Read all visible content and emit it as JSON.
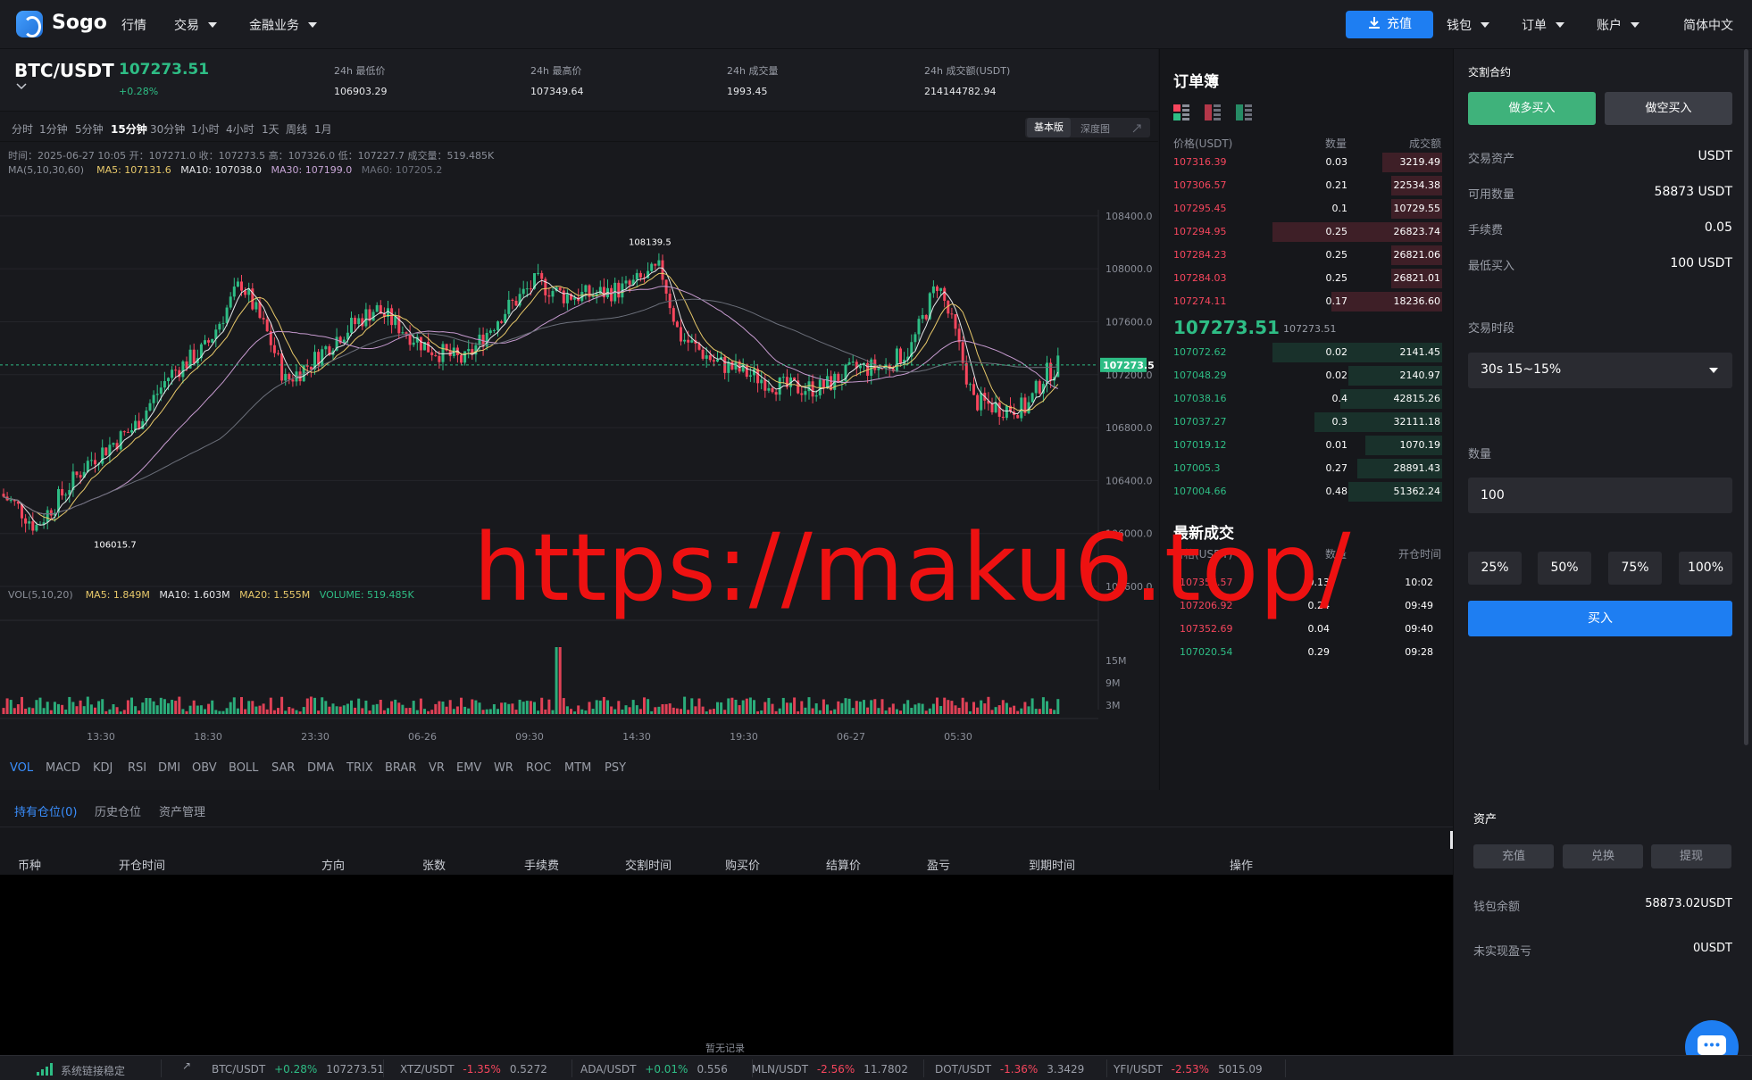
{
  "nav": {
    "brand": "Sogo",
    "items": [
      "行情",
      "交易",
      "金融业务"
    ],
    "recharge": "充值",
    "right_items": [
      "钱包",
      "订单",
      "账户"
    ],
    "language": "简体中文"
  },
  "ticker": {
    "pair": "BTC/USDT",
    "last": "107273.51",
    "change": "+0.28%",
    "stats": [
      {
        "label": "24h 最低价",
        "value": "106903.29"
      },
      {
        "label": "24h 最高价",
        "value": "107349.64"
      },
      {
        "label": "24h 成交量",
        "value": "1993.45"
      },
      {
        "label": "24h 成交额(USDT)",
        "value": "214144782.94"
      }
    ]
  },
  "timeframes": [
    "分时",
    "1分钟",
    "5分钟",
    "15分钟",
    "30分钟",
    "1小时",
    "4小时",
    "1天",
    "周线",
    "1月"
  ],
  "active_timeframe": "15分钟",
  "view_toggle": {
    "basic": "基本版",
    "depth": "深度图"
  },
  "chart_info": {
    "ohlc_line": "时间：2025-06-27 10:05    开：107271.0    收：107273.5    高：107326.0    低：107227.7    成交量：519.485K",
    "ma_label": "MA(5,10,30,60)",
    "ma5": "MA5: 107131.6",
    "ma10": "MA10: 107038.0",
    "ma30": "MA30: 107199.0",
    "ma60": "MA60: 107205.2",
    "vol_label": "VOL(5,10,20)",
    "vma5": "MA5: 1.849M",
    "vma10": "MA10: 1.603M",
    "vma20": "MA20: 1.555M",
    "volume": "VOLUME: 519.485K"
  },
  "chart_data": {
    "type": "candlestick",
    "price_axis": [
      "108400.0",
      "108000.0",
      "107600.0",
      "107200.0",
      "106800.0",
      "106400.0",
      "106000.0",
      "105600.0"
    ],
    "volume_axis": [
      "15M",
      "9M",
      "3M"
    ],
    "time_axis": [
      "13:30",
      "18:30",
      "23:30",
      "06-26",
      "09:30",
      "14:30",
      "19:30",
      "06-27",
      "05:30"
    ],
    "current_price_label": "107273.5",
    "high_marker": "108139.5",
    "low_marker": "106015.7",
    "ylim": [
      105600,
      108500
    ],
    "colors": {
      "up": "#2ebd85",
      "down": "#f6465d",
      "ma5": "#e6e7ea",
      "ma10": "#e8c96a",
      "ma30": "#c79bd0",
      "ma60": "#6b6f7a"
    }
  },
  "indicators": [
    "VOL",
    "MACD",
    "KDJ",
    "RSI",
    "DMI",
    "OBV",
    "BOLL",
    "SAR",
    "DMA",
    "TRIX",
    "BRAR",
    "VR",
    "EMV",
    "WR",
    "ROC",
    "MTM",
    "PSY"
  ],
  "orderbook": {
    "title": "订单簿",
    "headers": [
      "价格(USDT)",
      "数量",
      "成交额"
    ],
    "asks": [
      {
        "price": "107316.39",
        "qty": "0.03",
        "amount": "3219.49",
        "depth": 0.35
      },
      {
        "price": "107306.57",
        "qty": "0.21",
        "amount": "22534.38",
        "depth": 0.3
      },
      {
        "price": "107295.45",
        "qty": "0.1",
        "amount": "10729.55",
        "depth": 0.3
      },
      {
        "price": "107294.95",
        "qty": "0.25",
        "amount": "26823.74",
        "depth": 1.0
      },
      {
        "price": "107284.23",
        "qty": "0.25",
        "amount": "26821.06",
        "depth": 0.3
      },
      {
        "price": "107284.03",
        "qty": "0.25",
        "amount": "26821.01",
        "depth": 0.3
      },
      {
        "price": "107274.11",
        "qty": "0.17",
        "amount": "18236.60",
        "depth": 0.65
      }
    ],
    "mid_price": "107273.51",
    "mid_price_sub": "107273.51",
    "bids": [
      {
        "price": "107072.62",
        "qty": "0.02",
        "amount": "2141.45",
        "depth": 1.0
      },
      {
        "price": "107048.29",
        "qty": "0.02",
        "amount": "2140.97",
        "depth": 0.55
      },
      {
        "price": "107038.16",
        "qty": "0.4",
        "amount": "42815.26",
        "depth": 0.6
      },
      {
        "price": "107037.27",
        "qty": "0.3",
        "amount": "32111.18",
        "depth": 0.75
      },
      {
        "price": "107019.12",
        "qty": "0.01",
        "amount": "1070.19",
        "depth": 0.45
      },
      {
        "price": "107005.3",
        "qty": "0.27",
        "amount": "28891.43",
        "depth": 0.5
      },
      {
        "price": "107004.66",
        "qty": "0.48",
        "amount": "51362.24",
        "depth": 0.55
      }
    ],
    "trades_title": "最新成交",
    "trades_headers": [
      "价格(USDT)",
      "数量",
      "开仓时间"
    ],
    "trades": [
      {
        "price": "107356.57",
        "qty": "0.13",
        "time": "10:02",
        "side": "down"
      },
      {
        "price": "107206.92",
        "qty": "0.24",
        "time": "09:49",
        "side": "down"
      },
      {
        "price": "107352.69",
        "qty": "0.04",
        "time": "09:40",
        "side": "down"
      },
      {
        "price": "107020.54",
        "qty": "0.29",
        "time": "09:28",
        "side": "up"
      }
    ]
  },
  "trade": {
    "title": "交割合约",
    "buy_long": "做多买入",
    "buy_short": "做空买入",
    "rows": [
      {
        "label": "交易资产",
        "value": "USDT"
      },
      {
        "label": "可用数量",
        "value": "58873 USDT"
      },
      {
        "label": "手续费",
        "value": "0.05"
      },
      {
        "label": "最低买入",
        "value": "100 USDT"
      }
    ],
    "period_label": "交易时段",
    "period_value": "30s 15~15%",
    "qty_label": "数量",
    "qty_value": "100",
    "pcts": [
      "25%",
      "50%",
      "75%",
      "100%"
    ],
    "buy": "买入"
  },
  "positions": {
    "tabs": [
      "持有仓位(0)",
      "历史仓位",
      "资产管理"
    ],
    "columns": [
      "币种",
      "开仓时间",
      "方向",
      "张数",
      "手续费",
      "交割时间",
      "购买价",
      "结算价",
      "盈亏",
      "到期时间",
      "操作"
    ],
    "empty": "暂无记录"
  },
  "assets": {
    "title": "资产",
    "buttons": [
      "充值",
      "兑换",
      "提现"
    ],
    "wallet_label": "钱包余额",
    "wallet_value": "58873.02USDT",
    "pnl_label": "未实现盈亏",
    "pnl_value": "0USDT"
  },
  "statusbar": {
    "connection": "系统链接稳定",
    "tickers": [
      {
        "pair": "BTC/USDT",
        "change": "+0.28%",
        "price": "107273.51",
        "dir": "up"
      },
      {
        "pair": "XTZ/USDT",
        "change": "-1.35%",
        "price": "0.5272",
        "dir": "down"
      },
      {
        "pair": "ADA/USDT",
        "change": "+0.01%",
        "price": "0.556",
        "dir": "up"
      },
      {
        "pair": "MLN/USDT",
        "change": "-2.56%",
        "price": "11.7802",
        "dir": "down"
      },
      {
        "pair": "DOT/USDT",
        "change": "-1.36%",
        "price": "3.3429",
        "dir": "down"
      },
      {
        "pair": "YFI/USDT",
        "change": "-2.53%",
        "price": "5015.09",
        "dir": "down"
      }
    ]
  },
  "watermark": "https://maku6.top/"
}
